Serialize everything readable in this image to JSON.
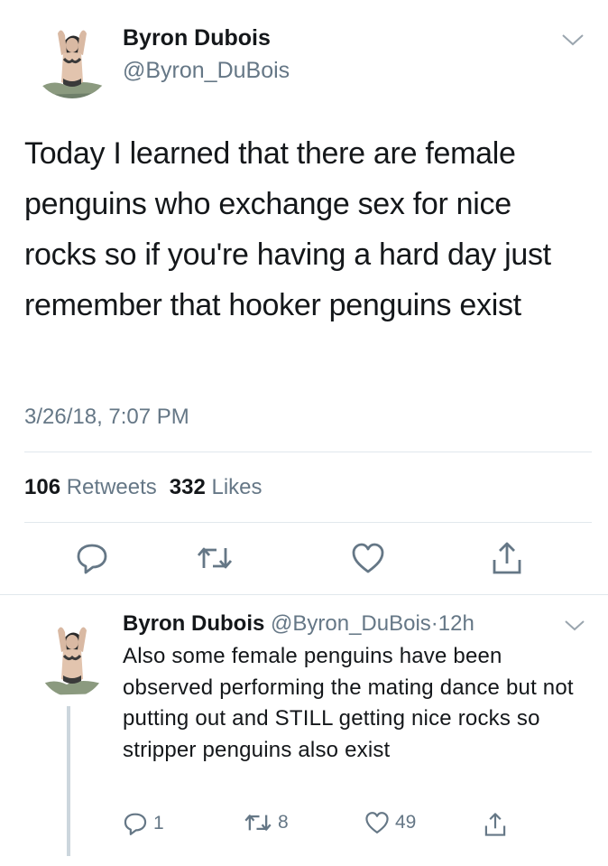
{
  "main_tweet": {
    "display_name": "Byron Dubois",
    "handle": "@Byron_DuBois",
    "text": "Today I learned that there are female penguins who exchange sex for nice rocks so if you're having a hard day just remember that hooker penguins exist",
    "timestamp": "3/26/18, 7:07 PM",
    "retweets_count": "106",
    "retweets_label": "Retweets",
    "likes_count": "332",
    "likes_label": "Likes",
    "icons": [
      "chevron-down-icon",
      "reply-icon",
      "retweet-icon",
      "like-icon",
      "share-icon"
    ]
  },
  "reply_tweet": {
    "display_name": "Byron Dubois",
    "handle": "@Byron_DuBois",
    "separator": "·",
    "time_ago": "12h",
    "text": "Also some female penguins have been observed performing the mating dance but not putting out and STILL getting nice rocks so stripper penguins also exist",
    "reply_count": "1",
    "retweet_count": "8",
    "like_count": "49"
  },
  "colors": {
    "text": "#14171a",
    "secondary": "#657786",
    "divider": "#e1e8ed",
    "thread_line": "#ccd6dd",
    "icon": "#657786"
  }
}
